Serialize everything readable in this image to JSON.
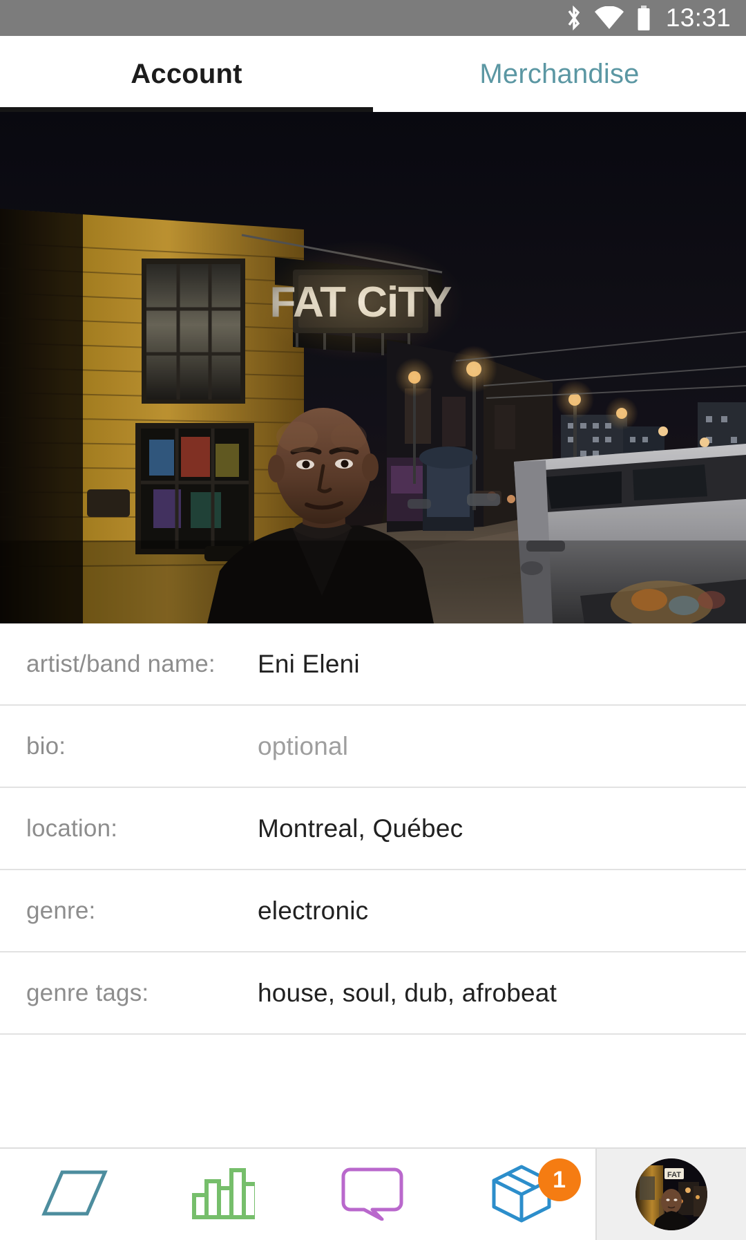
{
  "status_bar": {
    "time": "13:31",
    "icons": [
      "bluetooth-icon",
      "wifi-icon",
      "battery-icon"
    ]
  },
  "tabs": [
    {
      "label": "Account",
      "active": true
    },
    {
      "label": "Merchandise",
      "active": false
    }
  ],
  "hero": {
    "alt": "artist standing on a night street in front of the Fat City neon sign",
    "sign_text": "FAT CiTY"
  },
  "form": {
    "rows": [
      {
        "label": "artist/band name:",
        "value": "Eni Eleni",
        "is_placeholder": false
      },
      {
        "label": "bio:",
        "value": "optional",
        "is_placeholder": true
      },
      {
        "label": "location:",
        "value": "Montreal, Québec",
        "is_placeholder": false
      },
      {
        "label": "genre:",
        "value": "electronic",
        "is_placeholder": false
      },
      {
        "label": "genre tags:",
        "value": "house, soul, dub, afrobeat",
        "is_placeholder": false
      }
    ]
  },
  "bottom_nav": {
    "items": [
      {
        "icon": "parallelogram-icon",
        "color": "#4d8d9e"
      },
      {
        "icon": "bar-chart-icon",
        "color": "#76be6b"
      },
      {
        "icon": "speech-bubble-icon",
        "color": "#b濃"
      },
      {
        "icon": "package-box-icon",
        "color": "#2c8ecb",
        "badge": "1"
      },
      {
        "icon": "profile-avatar",
        "selected": true
      }
    ],
    "badge_count": "1",
    "badge_color": "#f57c12"
  },
  "colors": {
    "status_bar_bg": "#7c7c7c",
    "active_tab_text": "#1c1c1c",
    "inactive_tab_text": "#5b97a3",
    "tab_indicator": "#161616",
    "label_text": "#8d8d8d",
    "value_text": "#212121",
    "placeholder_text": "#9e9e9e",
    "divider": "#e2e2e2",
    "nav_parallelogram": "#4d8d9e",
    "nav_bars": "#76be6b",
    "nav_bubble": "#b968cc",
    "nav_box": "#2c8ecb",
    "badge_orange": "#f57c12",
    "avatar_cell_bg": "#efefef"
  }
}
